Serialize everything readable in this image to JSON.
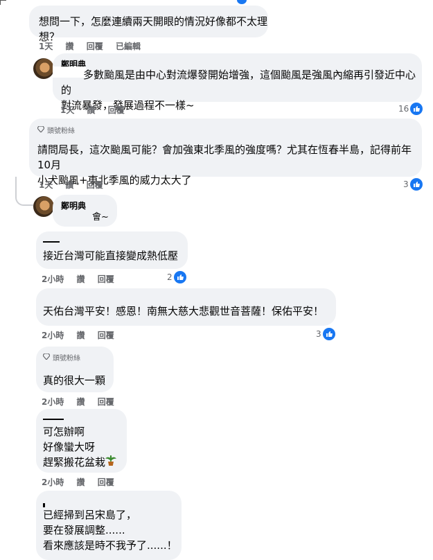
{
  "comments": [
    {
      "text": "想問一下，怎麼連續兩天開眼的情況好像都不太理想？",
      "time": "1天",
      "like": "讚",
      "reply": "回覆",
      "edited": "已編輯"
    },
    {
      "name": "鄭明典",
      "text": "多數颱風是由中心對流爆發開始增強，這個颱風是強風內縮再引發近中心的\n對流暴發，發展過程不一樣~",
      "time": "1天",
      "like": "讚",
      "reply": "回覆",
      "reactions": "16"
    },
    {
      "badge": "頭號粉絲",
      "text": "請問局長，這次颱風可能？會加強東北季風的強度嗎？尤其在恆春半島，記得前年10月\n小犬颱風+東北季風的威力太大了",
      "time": "1天",
      "like": "讚",
      "reply": "回覆",
      "reactions": "3"
    },
    {
      "name": "鄭明典",
      "text": "會~"
    },
    {
      "text": "接近台灣可能直接變成熱低壓",
      "time": "2小時",
      "like": "讚",
      "reply": "回覆",
      "reactions": "2"
    },
    {
      "text": "天佑台灣平安！感恩！南無大慈大悲觀世音菩薩！保佑平安！",
      "time": "2小時",
      "like": "讚",
      "reply": "回覆",
      "reactions": "3"
    },
    {
      "badge": "頭號粉絲",
      "text": "真的很大一顆",
      "time": "2小時",
      "like": "讚",
      "reply": "回覆"
    },
    {
      "text": "可怎辦啊\n好像蠻大呀\n趕緊搬花盆栽",
      "time": "2小時",
      "like": "讚",
      "reply": "回覆"
    },
    {
      "text": "已經掃到呂宋島了，\n要在發展調整......\n看來應該是時不我予了......！"
    }
  ],
  "colors": {
    "bubble": "#f0f2f5",
    "meta": "#65676b",
    "like_blue": "#1877f2"
  },
  "icons": {
    "like": "thumbs-up-icon",
    "badge": "diamond-icon",
    "plant": "potted-plant-icon"
  }
}
